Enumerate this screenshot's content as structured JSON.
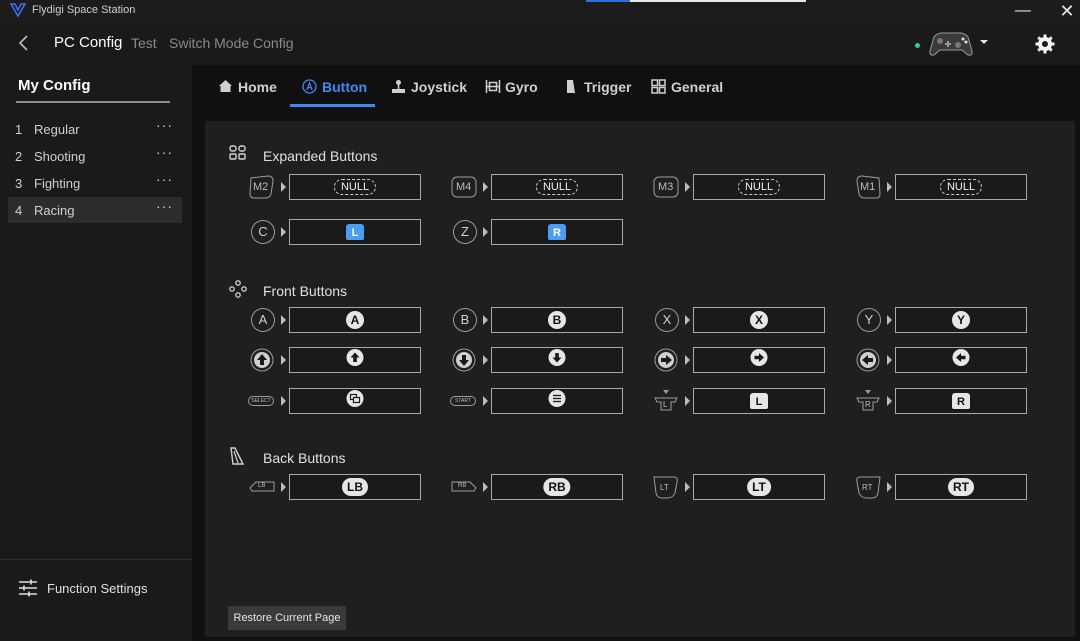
{
  "window": {
    "title": "Flydigi Space Station",
    "minimize_icon": "minimize-icon",
    "close_icon": "close-icon"
  },
  "nav": {
    "back_icon": "chevron-left-icon",
    "links": [
      "PC Config",
      "Test",
      "Switch Mode Config"
    ],
    "active": "PC Config",
    "status_color": "#2fd07c",
    "settings_icon": "gear-icon"
  },
  "sidebar": {
    "title": "My Config",
    "items": [
      {
        "num": "1",
        "label": "Regular",
        "more": "···"
      },
      {
        "num": "2",
        "label": "Shooting",
        "more": "···"
      },
      {
        "num": "3",
        "label": "Fighting",
        "more": "···"
      },
      {
        "num": "4",
        "label": "Racing",
        "more": "···"
      }
    ],
    "selected_index": 3,
    "footer": "Function Settings"
  },
  "tabs": [
    {
      "label": "Home",
      "icon": "home-icon"
    },
    {
      "label": "Button",
      "icon": "a-button-icon"
    },
    {
      "label": "Joystick",
      "icon": "joystick-icon"
    },
    {
      "label": "Gyro",
      "icon": "gyro-icon"
    },
    {
      "label": "Trigger",
      "icon": "trigger-icon"
    },
    {
      "label": "General",
      "icon": "grid-icon"
    }
  ],
  "active_tab": "Button",
  "accent_color": "#3b8cf2",
  "sections": {
    "expanded": {
      "title": "Expanded Buttons",
      "rows": [
        [
          {
            "source": "M2",
            "target": "NULL"
          },
          {
            "source": "M4",
            "target": "NULL"
          },
          {
            "source": "M3",
            "target": "NULL"
          },
          {
            "source": "M1",
            "target": "NULL"
          }
        ],
        [
          {
            "source": "C",
            "target": "L"
          },
          {
            "source": "Z",
            "target": "R"
          }
        ]
      ]
    },
    "front": {
      "title": "Front Buttons",
      "rows": [
        [
          {
            "source": "A",
            "target": "A"
          },
          {
            "source": "B",
            "target": "B"
          },
          {
            "source": "X",
            "target": "X"
          },
          {
            "source": "Y",
            "target": "Y"
          }
        ],
        [
          {
            "source": "up-arrow-icon",
            "target": "up-arrow-icon"
          },
          {
            "source": "down-arrow-icon",
            "target": "down-arrow-icon"
          },
          {
            "source": "right-arrow-icon",
            "target": "right-arrow-icon"
          },
          {
            "source": "left-arrow-icon",
            "target": "left-arrow-icon"
          }
        ],
        [
          {
            "source": "SELECT",
            "target": "view-icon"
          },
          {
            "source": "START",
            "target": "menu-icon"
          },
          {
            "source": "L",
            "target": "L"
          },
          {
            "source": "R",
            "target": "R"
          }
        ]
      ]
    },
    "back": {
      "title": "Back Buttons",
      "rows": [
        [
          {
            "source": "LB",
            "target": "LB"
          },
          {
            "source": "RB",
            "target": "RB"
          },
          {
            "source": "LT",
            "target": "LT"
          },
          {
            "source": "RT",
            "target": "RT"
          }
        ]
      ]
    }
  },
  "restore_button": "Restore Current Page"
}
